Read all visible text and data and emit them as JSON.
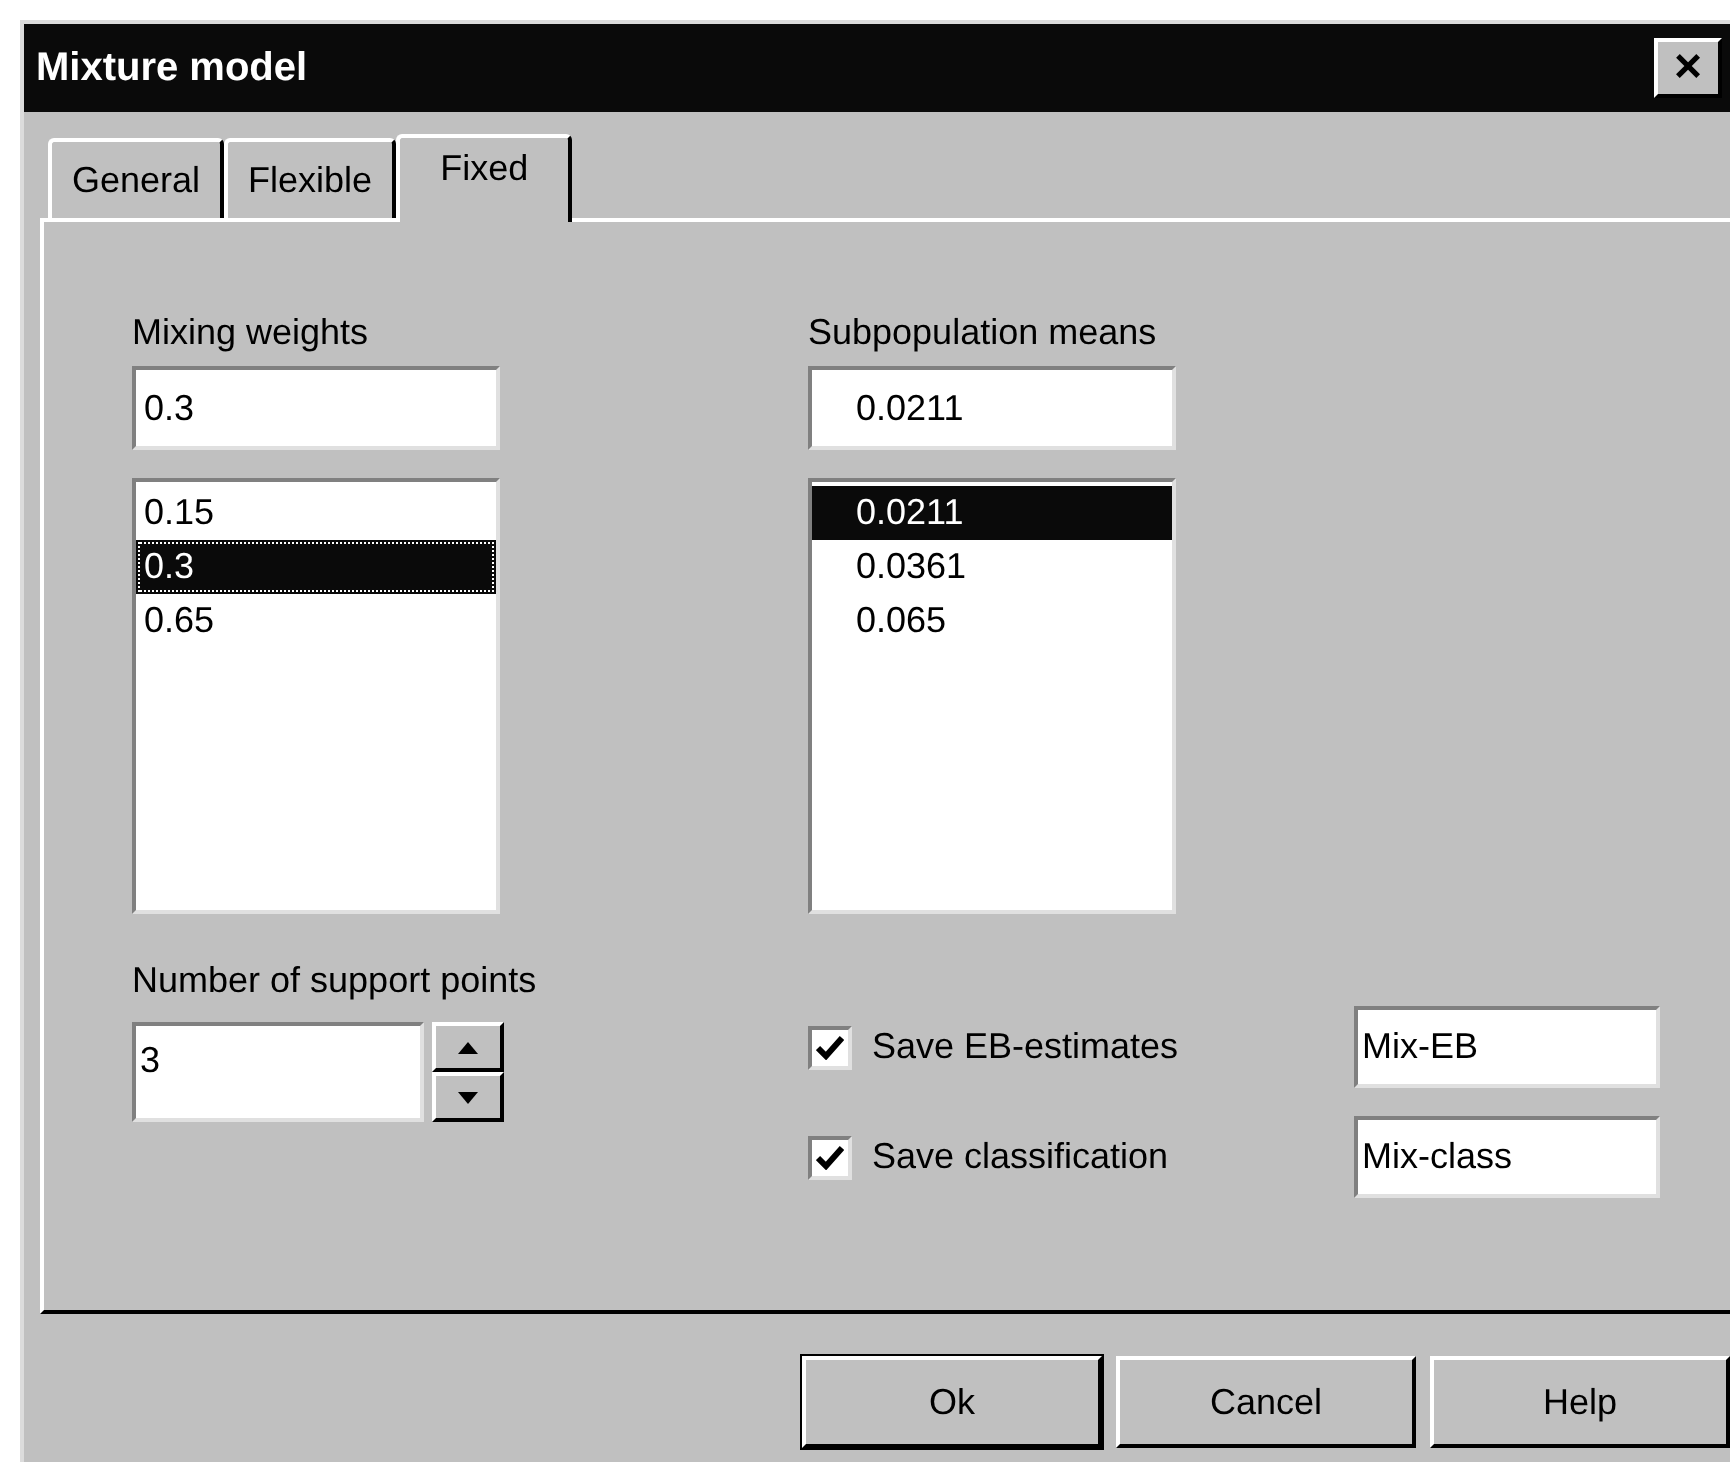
{
  "window": {
    "title": "Mixture model",
    "close": "×"
  },
  "tabs": [
    {
      "label": "General",
      "selected": false
    },
    {
      "label": "Flexible",
      "selected": false
    },
    {
      "label": "Fixed",
      "selected": true
    }
  ],
  "weights": {
    "label": "Mixing weights",
    "value": "0.3",
    "focused": true,
    "items": [
      {
        "text": "0.15",
        "selected": false
      },
      {
        "text": "0.3",
        "selected": true
      },
      {
        "text": "0.65",
        "selected": false
      }
    ]
  },
  "means": {
    "label": "Subpopulation means",
    "value": "0.0211",
    "focused": false,
    "items": [
      {
        "text": "0.0211",
        "selected": true
      },
      {
        "text": "0.0361",
        "selected": false
      },
      {
        "text": "0.065",
        "selected": false
      }
    ]
  },
  "support_points": {
    "label": "Number of support points",
    "value": "3"
  },
  "options": [
    {
      "label": "Save EB-estimates",
      "checked": true,
      "value": "Mix-EB"
    },
    {
      "label": "Save classification",
      "checked": true,
      "value": "Mix-class"
    }
  ],
  "buttons": [
    "Ok",
    "Cancel",
    "Help"
  ]
}
